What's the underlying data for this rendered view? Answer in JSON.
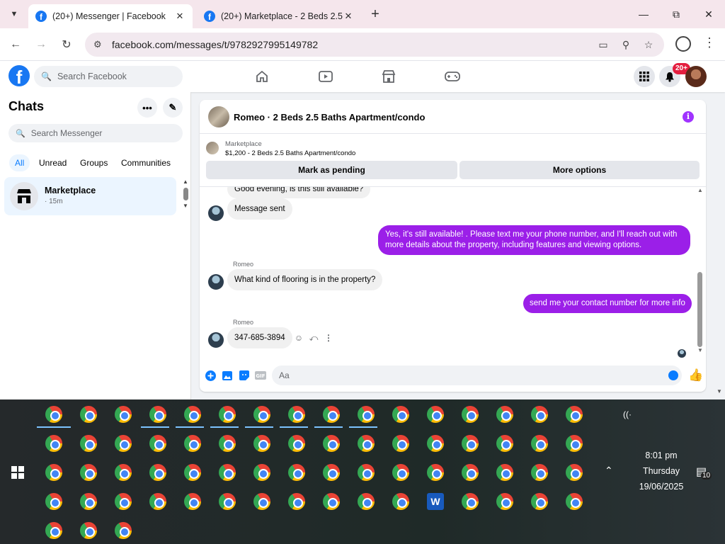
{
  "browser": {
    "tabs": [
      {
        "label": "(20+) Messenger | Facebook",
        "active": true
      },
      {
        "label": "(20+) Marketplace - 2 Beds 2.5",
        "active": false
      }
    ],
    "url": "facebook.com/messages/t/9782927995149782"
  },
  "fb": {
    "search_placeholder": "Search Facebook",
    "notification_count": "20+",
    "logo": "f"
  },
  "sidebar": {
    "title": "Chats",
    "search_placeholder": "Search Messenger",
    "filters": [
      "All",
      "Unread",
      "Groups",
      "Communities"
    ],
    "active_filter": "All",
    "chats": [
      {
        "name": "Marketplace",
        "time": "· 15m"
      }
    ]
  },
  "conversation": {
    "title": "Romeo · 2 Beds 2.5 Baths Apartment/condo",
    "marketplace_label": "Marketplace",
    "listing": "$1,200 - 2 Beds 2.5 Baths Apartment/condo",
    "buttons": {
      "mark_pending": "Mark as pending",
      "more_options": "More options"
    },
    "messages": [
      {
        "from": "them",
        "text": "Good evening, is this still available?"
      },
      {
        "from": "them",
        "text": "Message sent"
      },
      {
        "from": "me",
        "text": "Yes, it's still available! . Please text me your phone number, and I'll reach out with more details about the property, including features and viewing options."
      },
      {
        "from": "them",
        "sender": "Romeo",
        "text": "What kind of flooring is in the property?"
      },
      {
        "from": "me",
        "text": "send me your contact number for more info"
      },
      {
        "from": "them",
        "sender": "Romeo",
        "text": "347-685-3894"
      }
    ],
    "composer_placeholder": "Aa",
    "accent_color": "#9b1fe8"
  },
  "taskbar": {
    "time": "8:01 pm",
    "day": "Thursday",
    "date": "19/06/2025",
    "notification_count": "10"
  },
  "icons": {
    "desktop_apps": "chrome-icon",
    "word_app": "word-icon"
  }
}
